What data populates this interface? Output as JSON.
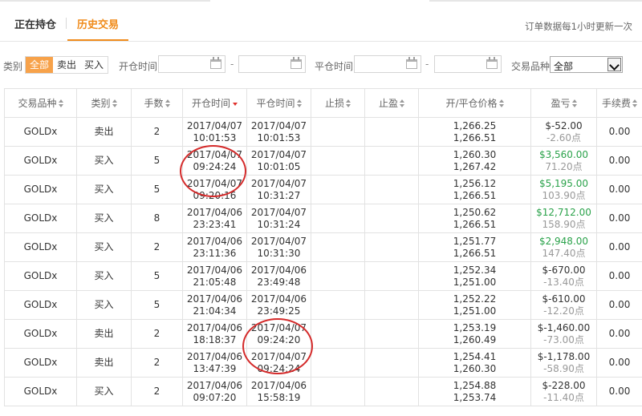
{
  "tabs": {
    "holding": "正在持仓",
    "history": "历史交易",
    "update_note": "订单数据每1小时更新一次"
  },
  "filter": {
    "type_label": "类别",
    "type_options": [
      "全部",
      "卖出",
      "买入"
    ],
    "open_time_label": "开仓时间",
    "close_time_label": "平仓时间",
    "dash": "-",
    "product_label": "交易品种",
    "product_selected": "全部"
  },
  "columns": [
    "交易品种",
    "类别",
    "手数",
    "开仓时间",
    "平仓时间",
    "止损",
    "止盈",
    "开/平仓价格",
    "盈亏",
    "手续费"
  ],
  "rows": [
    {
      "product": "GOLDx",
      "side": "卖出",
      "side_type": "sell",
      "lots": "2",
      "open_date": "2017/04/07",
      "open_time": "10:01:53",
      "close_date": "2017/04/07",
      "close_time": "10:01:53",
      "sl": "",
      "tp": "",
      "open_price": "1,266.25",
      "close_price": "1,266.51",
      "pnl": "$-52.00",
      "pnl_type": "neg",
      "points": "-2.60点",
      "fee": "0.00"
    },
    {
      "product": "GOLDx",
      "side": "买入",
      "side_type": "buy",
      "lots": "5",
      "open_date": "2017/04/07",
      "open_time": "09:24:24",
      "close_date": "2017/04/07",
      "close_time": "10:01:05",
      "sl": "",
      "tp": "",
      "open_price": "1,260.30",
      "close_price": "1,267.42",
      "pnl": "$3,560.00",
      "pnl_type": "pos",
      "points": "71.20点",
      "fee": "0.00"
    },
    {
      "product": "GOLDx",
      "side": "买入",
      "side_type": "buy",
      "lots": "5",
      "open_date": "2017/04/07",
      "open_time": "09:20:16",
      "close_date": "2017/04/07",
      "close_time": "10:31:27",
      "sl": "",
      "tp": "",
      "open_price": "1,256.12",
      "close_price": "1,266.51",
      "pnl": "$5,195.00",
      "pnl_type": "pos",
      "points": "103.90点",
      "fee": "0.00"
    },
    {
      "product": "GOLDx",
      "side": "买入",
      "side_type": "buy",
      "lots": "8",
      "open_date": "2017/04/06",
      "open_time": "23:23:41",
      "close_date": "2017/04/07",
      "close_time": "10:31:24",
      "sl": "",
      "tp": "",
      "open_price": "1,250.62",
      "close_price": "1,266.51",
      "pnl": "$12,712.00",
      "pnl_type": "pos",
      "points": "158.90点",
      "fee": "0.00"
    },
    {
      "product": "GOLDx",
      "side": "买入",
      "side_type": "buy",
      "lots": "2",
      "open_date": "2017/04/06",
      "open_time": "23:11:36",
      "close_date": "2017/04/07",
      "close_time": "10:31:30",
      "sl": "",
      "tp": "",
      "open_price": "1,251.77",
      "close_price": "1,266.51",
      "pnl": "$2,948.00",
      "pnl_type": "pos",
      "points": "147.40点",
      "fee": "0.00"
    },
    {
      "product": "GOLDx",
      "side": "买入",
      "side_type": "buy",
      "lots": "5",
      "open_date": "2017/04/06",
      "open_time": "21:05:48",
      "close_date": "2017/04/06",
      "close_time": "23:49:48",
      "sl": "",
      "tp": "",
      "open_price": "1,252.34",
      "close_price": "1,251.00",
      "pnl": "$-670.00",
      "pnl_type": "neg",
      "points": "-13.40点",
      "fee": "0.00"
    },
    {
      "product": "GOLDx",
      "side": "买入",
      "side_type": "buy",
      "lots": "5",
      "open_date": "2017/04/06",
      "open_time": "21:04:34",
      "close_date": "2017/04/06",
      "close_time": "23:49:25",
      "sl": "",
      "tp": "",
      "open_price": "1,252.22",
      "close_price": "1,251.00",
      "pnl": "$-610.00",
      "pnl_type": "neg",
      "points": "-12.20点",
      "fee": "0.00"
    },
    {
      "product": "GOLDx",
      "side": "卖出",
      "side_type": "sell",
      "lots": "2",
      "open_date": "2017/04/06",
      "open_time": "18:18:37",
      "close_date": "2017/04/07",
      "close_time": "09:24:20",
      "sl": "",
      "tp": "",
      "open_price": "1,253.19",
      "close_price": "1,260.49",
      "pnl": "$-1,460.00",
      "pnl_type": "neg",
      "points": "-73.00点",
      "fee": "0.00"
    },
    {
      "product": "GOLDx",
      "side": "卖出",
      "side_type": "sell",
      "lots": "2",
      "open_date": "2017/04/06",
      "open_time": "13:47:39",
      "close_date": "2017/04/07",
      "close_time": "09:24:24",
      "sl": "",
      "tp": "",
      "open_price": "1,254.41",
      "close_price": "1,260.30",
      "pnl": "$-1,178.00",
      "pnl_type": "neg",
      "points": "-58.90点",
      "fee": "0.00"
    },
    {
      "product": "GOLDx",
      "side": "买入",
      "side_type": "buy",
      "lots": "2",
      "open_date": "2017/04/06",
      "open_time": "09:07:20",
      "close_date": "2017/04/06",
      "close_time": "15:58:19",
      "sl": "",
      "tp": "",
      "open_price": "1,254.88",
      "close_price": "1,253.74",
      "pnl": "$-228.00",
      "pnl_type": "neg",
      "points": "-11.40点",
      "fee": "0.00"
    }
  ]
}
